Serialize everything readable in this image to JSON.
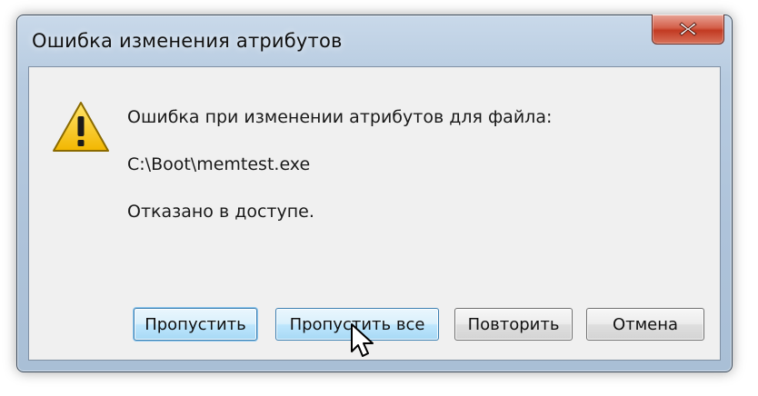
{
  "dialog": {
    "title": "Ошибка изменения атрибутов",
    "icon": "warning-icon",
    "message_line1": "Ошибка при изменении атрибутов для файла:",
    "file_path": "C:\\Boot\\memtest.exe",
    "message_line3": "Отказано в доступе."
  },
  "buttons": {
    "skip": "Пропустить",
    "skip_all": "Пропустить все",
    "retry": "Повторить",
    "cancel": "Отмена"
  },
  "colors": {
    "close_button": "#c94a32",
    "default_button_border": "#3c7fb1",
    "warning_fill": "#f5c400"
  }
}
